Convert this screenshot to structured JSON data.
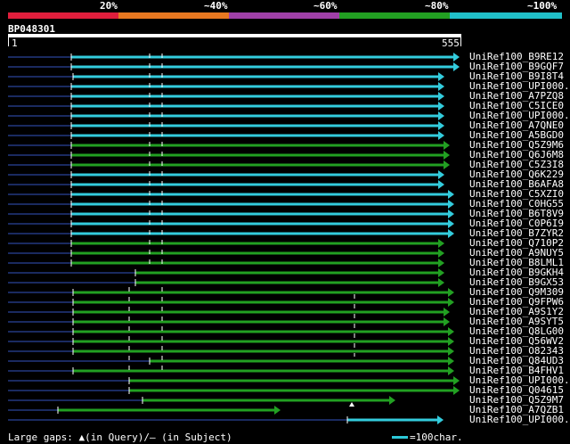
{
  "legend": {
    "labels": [
      "20%",
      "~40%",
      "~60%",
      "~80%",
      "~100%"
    ],
    "colors": [
      "#e01e3c",
      "#e87820",
      "#a040a8",
      "#22a022",
      "#20c0c8"
    ]
  },
  "query": {
    "name": "BP048301",
    "start": "1",
    "end": "555"
  },
  "hits": [
    {
      "name": "UniRef100_B9RE12",
      "color": "cyan"
    },
    {
      "name": "UniRef100_B9GQF7",
      "color": "cyan"
    },
    {
      "name": "UniRef100_B9I8T4",
      "color": "cyan"
    },
    {
      "name": "UniRef100_UPI000..",
      "color": "cyan"
    },
    {
      "name": "UniRef100_A7PZQ8",
      "color": "cyan"
    },
    {
      "name": "UniRef100_C5ICE0",
      "color": "cyan"
    },
    {
      "name": "UniRef100_UPI000..",
      "color": "cyan"
    },
    {
      "name": "UniRef100_A7QNE0",
      "color": "cyan"
    },
    {
      "name": "UniRef100_A5BGD0",
      "color": "cyan"
    },
    {
      "name": "UniRef100_Q5Z9M6",
      "color": "green"
    },
    {
      "name": "UniRef100_Q6J6M8",
      "color": "green"
    },
    {
      "name": "UniRef100_C5Z3I8",
      "color": "green"
    },
    {
      "name": "UniRef100_Q6K229",
      "color": "cyan"
    },
    {
      "name": "UniRef100_B6AFA8",
      "color": "cyan"
    },
    {
      "name": "UniRef100_C5XZI0",
      "color": "cyan"
    },
    {
      "name": "UniRef100_C0HG55",
      "color": "cyan"
    },
    {
      "name": "UniRef100_B6T8V9",
      "color": "cyan"
    },
    {
      "name": "UniRef100_C0P6I9",
      "color": "cyan"
    },
    {
      "name": "UniRef100_B7ZYR2",
      "color": "cyan"
    },
    {
      "name": "UniRef100_Q710P2",
      "color": "green"
    },
    {
      "name": "UniRef100_A9NUY5",
      "color": "green"
    },
    {
      "name": "UniRef100_B8LML1",
      "color": "green"
    },
    {
      "name": "UniRef100_B9GKH4",
      "color": "green"
    },
    {
      "name": "UniRef100_B9GX53",
      "color": "green"
    },
    {
      "name": "UniRef100_Q9M309",
      "color": "green"
    },
    {
      "name": "UniRef100_Q9FPW6",
      "color": "green"
    },
    {
      "name": "UniRef100_A9S1Y2",
      "color": "green"
    },
    {
      "name": "UniRef100_A9SYT5",
      "color": "green"
    },
    {
      "name": "UniRef100_Q8LG00",
      "color": "green"
    },
    {
      "name": "UniRef100_Q56WV2",
      "color": "green"
    },
    {
      "name": "UniRef100_O82343",
      "color": "green"
    },
    {
      "name": "UniRef100_Q84UD3",
      "color": "green"
    },
    {
      "name": "UniRef100_B4FHV1",
      "color": "green"
    },
    {
      "name": "UniRef100_UPI000..",
      "color": "green"
    },
    {
      "name": "UniRef100_Q04615",
      "color": "green"
    },
    {
      "name": "UniRef100_Q5Z9M7",
      "color": "green"
    },
    {
      "name": "UniRef100_A7QZB1",
      "color": "green"
    },
    {
      "name": "UniRef100_UPI000..",
      "color": "cyan"
    }
  ],
  "footer": {
    "gaps": "Large gaps: ▲(in Query)/— (in Subject)",
    "scale": "=100char."
  }
}
